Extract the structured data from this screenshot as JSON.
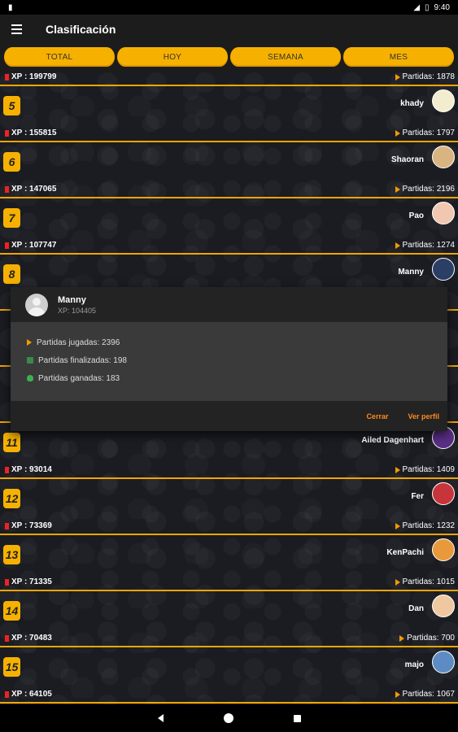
{
  "status_bar": {
    "time": "9:40"
  },
  "app_bar": {
    "title": "Clasificación"
  },
  "tabs": [
    {
      "label": "TOTAL"
    },
    {
      "label": "HOY"
    },
    {
      "label": "SEMANA"
    },
    {
      "label": "MES"
    }
  ],
  "rows": [
    {
      "rank": "",
      "name": "",
      "xp": "XP : 199799",
      "games": "Partidas: 1878",
      "avatar_color": ""
    },
    {
      "rank": "5",
      "name": "khady",
      "xp": "XP : 155815",
      "games": "Partidas: 1797",
      "avatar_color": "#f4eccf"
    },
    {
      "rank": "6",
      "name": "Shaoran",
      "xp": "XP : 147065",
      "games": "Partidas: 2196",
      "avatar_color": "#d9b480"
    },
    {
      "rank": "7",
      "name": "Pao",
      "xp": "XP : 107747",
      "games": "Partidas: 1274",
      "avatar_color": "#f1c7b0"
    },
    {
      "rank": "8",
      "name": "Manny",
      "xp": "",
      "games": "",
      "avatar_color": "#2b3e66"
    },
    {
      "rank": "11",
      "name": "Ailed Dagenhart",
      "xp": "XP : 93014",
      "games": "Partidas: 1409",
      "avatar_color": "#5a2e86"
    },
    {
      "rank": "12",
      "name": "Fer",
      "xp": "XP : 73369",
      "games": "Partidas: 1232",
      "avatar_color": "#c8343b"
    },
    {
      "rank": "13",
      "name": "KenPachi",
      "xp": "XP : 71335",
      "games": "Partidas: 1015",
      "avatar_color": "#e89a3a"
    },
    {
      "rank": "14",
      "name": "Dan",
      "xp": "XP : 70483",
      "games": "Partidas: 700",
      "avatar_color": "#f0c8a0"
    },
    {
      "rank": "15",
      "name": "majo",
      "xp": "XP : 64105",
      "games": "Partidas: 1067",
      "avatar_color": "#5d8cc4"
    }
  ],
  "dialog": {
    "name": "Manny",
    "xp": "XP: 104405",
    "stats": [
      {
        "label": "Partidas jugadas: 2396",
        "icon": "play-icon"
      },
      {
        "label": "Partidas finalizadas: 198",
        "icon": "flag-icon"
      },
      {
        "label": "Partidas ganadas: 183",
        "icon": "trophy-icon"
      }
    ],
    "close_label": "Cerrar",
    "profile_label": "Ver perfil"
  },
  "colors": {
    "accent": "#f6b100",
    "dialog_button": "#ff8a1c",
    "xp_marker": "#ee2222"
  }
}
